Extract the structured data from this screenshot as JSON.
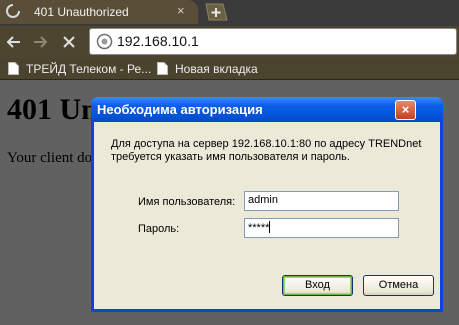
{
  "browser": {
    "tab": {
      "title": "401 Unauthorized",
      "close_glyph": "×"
    },
    "omnibox": {
      "url": "192.168.10.1"
    },
    "bookmarks": [
      {
        "label": "ТРЕЙД Телеком - Ре..."
      },
      {
        "label": "Новая вкладка"
      }
    ]
  },
  "page": {
    "heading": "401 Un",
    "body_text": "Your client do"
  },
  "dialog": {
    "title": "Необходима авторизация",
    "close_glyph": "×",
    "message_line1": "Для доступа на сервер 192.168.10.1:80 по адресу TRENDnet",
    "message_line2": "требуется указать имя пользователя и пароль.",
    "username_label": "Имя пользователя:",
    "username_value": "admin",
    "password_label": "Пароль:",
    "password_value": "*****",
    "login_button": "Вход",
    "cancel_button": "Отмена"
  },
  "colors": {
    "titlebar": "#0553d8",
    "dialog_bg": "#ece9d8",
    "chrome_toolbar": "#4d452f"
  }
}
